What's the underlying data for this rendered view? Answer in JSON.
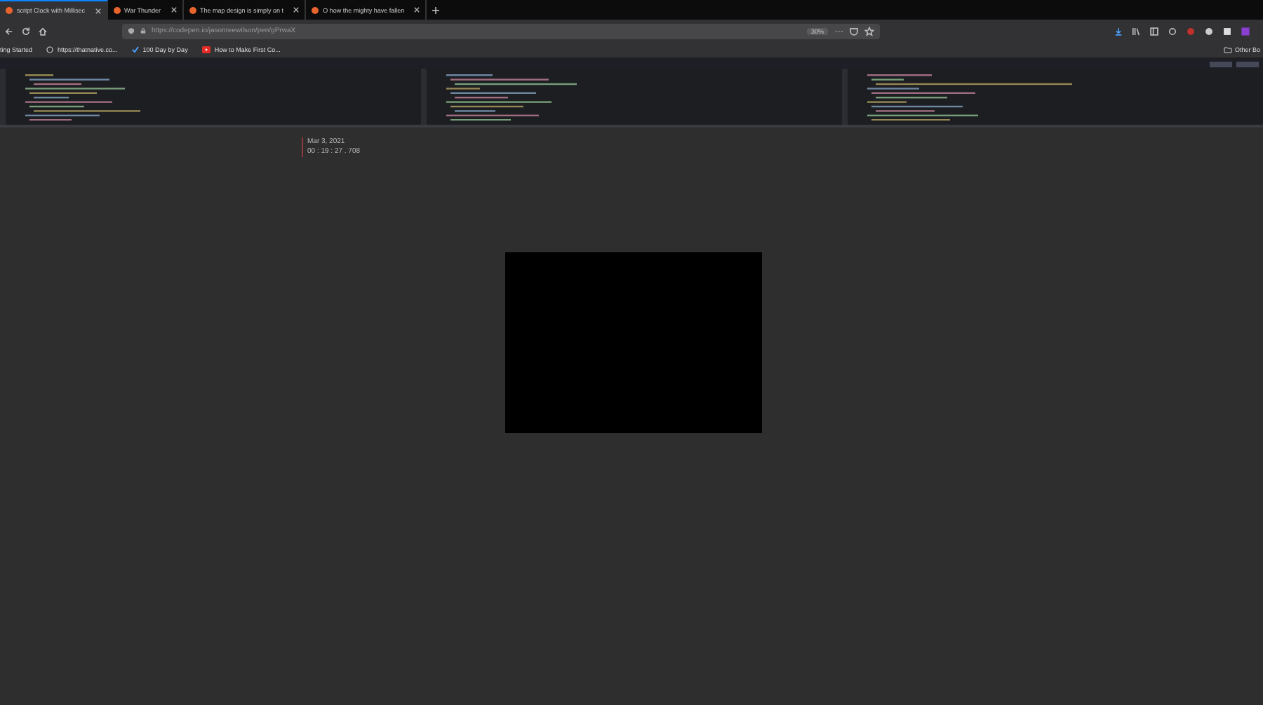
{
  "browser": {
    "tabs": [
      {
        "title": "script Clock with Millisec",
        "selected": true
      },
      {
        "title": "War Thunder",
        "selected": false
      },
      {
        "title": "The map design is simply on t",
        "selected": false
      },
      {
        "title": "O how the mighty have fallen",
        "selected": false
      }
    ],
    "url": "https://codepen.io/jasonreewilson/pen/gPrwaX",
    "zoom": "30%",
    "bookmarks": [
      "ting Started",
      "https://thatnative.co...",
      "100 Day by Day",
      "How to Make First Co..."
    ],
    "other_bookmarks": "Other Bo"
  },
  "pen": {
    "date": "Mar 3, 2021",
    "time": "00 : 19 : 27 . 708"
  }
}
